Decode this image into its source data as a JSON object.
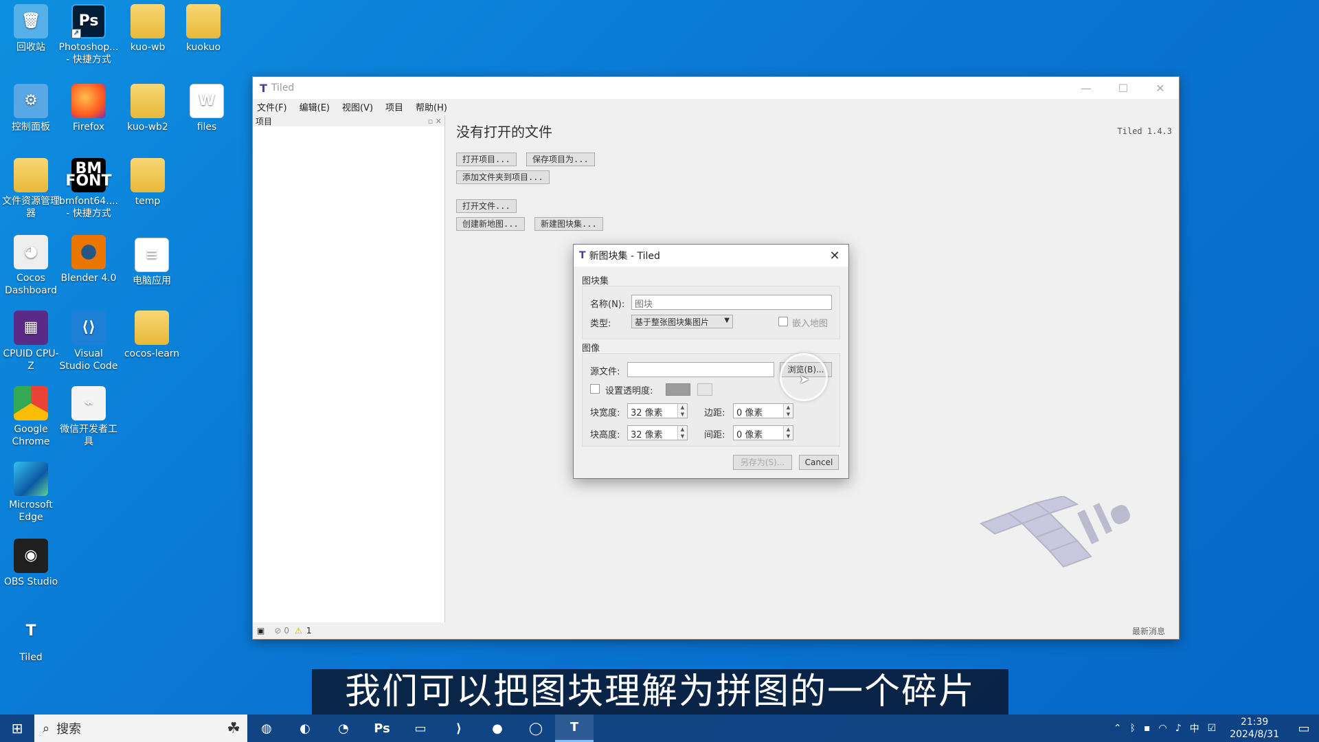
{
  "desktop": {
    "icons": [
      {
        "label": "回收站",
        "icon": "recycle-bin-icon"
      },
      {
        "label": "Photoshop... - 快捷方式",
        "icon": "photoshop-icon"
      },
      {
        "label": "kuo-wb",
        "icon": "folder-icon"
      },
      {
        "label": "kuokuo",
        "icon": "folder-icon"
      },
      {
        "label": "控制面板",
        "icon": "control-panel-icon"
      },
      {
        "label": "Firefox",
        "icon": "firefox-icon"
      },
      {
        "label": "kuo-wb2",
        "icon": "folder-icon"
      },
      {
        "label": "files",
        "icon": "word-file-icon"
      },
      {
        "label": "文件资源管理器",
        "icon": "file-explorer-icon"
      },
      {
        "label": "bmfont64.... - 快捷方式",
        "icon": "bmfont-icon"
      },
      {
        "label": "temp",
        "icon": "folder-icon"
      },
      {
        "label": "Cocos Dashboard",
        "icon": "cocos-icon"
      },
      {
        "label": "Blender 4.0",
        "icon": "blender-icon"
      },
      {
        "label": "电脑应用",
        "icon": "file-icon"
      },
      {
        "label": "CPUID CPU-Z",
        "icon": "cpuz-icon"
      },
      {
        "label": "Visual Studio Code",
        "icon": "vscode-icon"
      },
      {
        "label": "cocos-learn",
        "icon": "folder-icon"
      },
      {
        "label": "Google Chrome",
        "icon": "chrome-icon"
      },
      {
        "label": "微信开发者工具",
        "icon": "wechat-devtools-icon"
      },
      {
        "label": "Microsoft Edge",
        "icon": "edge-icon"
      },
      {
        "label": "OBS Studio",
        "icon": "obs-icon"
      },
      {
        "label": "Tiled",
        "icon": "tiled-icon"
      }
    ],
    "ps_glyph": "Ps",
    "bm_glyph": "BM FONT",
    "tiled_glyph": "T"
  },
  "main_window": {
    "title": "Tiled",
    "app_glyph": "T",
    "controls": {
      "minimize": "—",
      "maximize": "☐",
      "close": "✕"
    },
    "menu": [
      "文件(F)",
      "编辑(E)",
      "视图(V)",
      "项目",
      "帮助(H)"
    ],
    "project_panel_title": "项目",
    "project_panel_ctl": "▫ ✕",
    "no_file_title": "没有打开的文件",
    "version": "Tiled 1.4.3",
    "buttons": {
      "open_project": "打开项目...",
      "save_project_as": "保存项目为...",
      "add_folder": "添加文件夹到项目...",
      "open_file": "打开文件...",
      "new_map": "创建新地图...",
      "new_tileset": "新建图块集..."
    },
    "status": {
      "errors": "0",
      "warnings": "1",
      "news": "最新消息"
    }
  },
  "dialog": {
    "title": "新图块集 - Tiled",
    "app_glyph": "T",
    "close_glyph": "✕",
    "tileset_group": "图块集",
    "name_label": "名称(N):",
    "name_value": "图块",
    "type_label": "类型:",
    "type_value": "基于整张图块集图片",
    "embed_label": "嵌入地图",
    "image_group": "图像",
    "source_label": "源文件:",
    "source_value": "",
    "browse_button": "浏览(B)...",
    "transparency_label": "设置透明度:",
    "tile_width_label": "块宽度:",
    "tile_width_value": "32 像素",
    "tile_height_label": "块高度:",
    "tile_height_value": "32 像素",
    "margin_label": "边距:",
    "margin_value": "0 像素",
    "spacing_label": "间距:",
    "spacing_value": "0 像素",
    "save_as_button": "另存为(S)...",
    "cancel_button": "Cancel"
  },
  "subtitle": "我们可以把图块理解为拼图的一个碎片",
  "taskbar": {
    "search_placeholder": "搜索",
    "apps": [
      "chrome-icon",
      "firefox-icon",
      "edge-icon",
      "photoshop-icon",
      "file-explorer-icon",
      "vscode-icon",
      "davinci-icon",
      "cocos-icon",
      "tiled-icon"
    ],
    "time": "21:39",
    "date": "2024/8/31",
    "ime": "中"
  }
}
